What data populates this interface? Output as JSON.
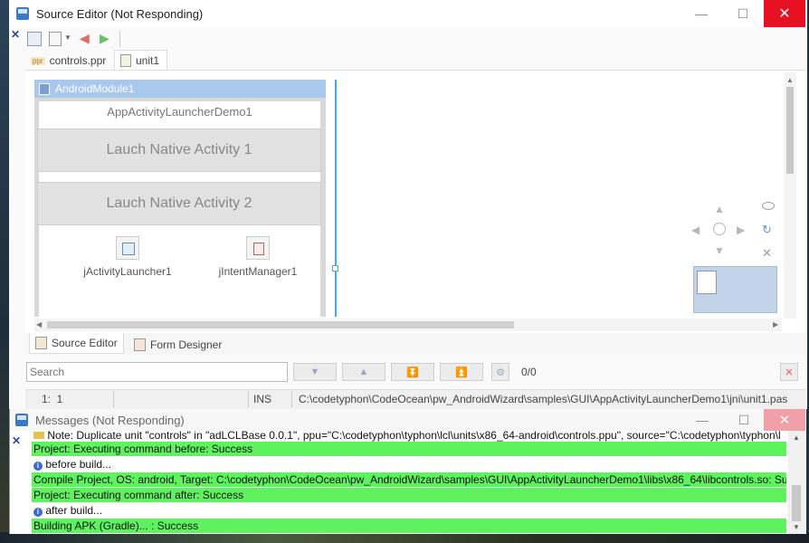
{
  "editor": {
    "title": "Source Editor (Not Responding)",
    "tabs": [
      "controls.ppr",
      "unit1"
    ],
    "tab_badge": "ppr",
    "bottom_tabs": [
      "Source Editor",
      "Form Designer"
    ],
    "search_placeholder": "Search",
    "search_count": "0/0",
    "status": {
      "position": "1:  1",
      "mode": "INS",
      "path": "C:\\codetyphon\\CodeOcean\\pw_AndroidWizard\\samples\\GUI\\AppActivityLauncherDemo1\\jni\\unit1.pas"
    }
  },
  "form": {
    "module_title": "AndroidModule1",
    "app_label": "AppActivityLauncherDemo1",
    "button1": "Lauch Native Activity 1",
    "button2": "Lauch Native Activity 2",
    "component1": "jActivityLauncher1",
    "component2": "jIntentManager1"
  },
  "messages": {
    "title": "Messages (Not Responding)",
    "lines": [
      {
        "text": "Note: Duplicate unit \"controls\" in \"adLCLBase 0.0.1\", ppu=\"C:\\codetyphon\\typhon\\lcl\\units\\x86_64-android\\controls.ppu\", source=\"C:\\codetyphon\\typhon\\l",
        "style": "white",
        "icon": "folder"
      },
      {
        "text": "Project: Executing command before: Success",
        "style": "green"
      },
      {
        "text": "before build...",
        "style": "white",
        "icon": "info"
      },
      {
        "text": "Compile Project, OS: android, Target: C:\\codetyphon\\CodeOcean\\pw_AndroidWizard\\samples\\GUI\\AppActivityLauncherDemo1\\libs\\x86_64\\libcontrols.so: Succ",
        "style": "green"
      },
      {
        "text": "Project: Executing command after: Success",
        "style": "green"
      },
      {
        "text": "after build...",
        "style": "white",
        "icon": "info"
      },
      {
        "text": "Building APK (Gradle)... : Success",
        "style": "green"
      }
    ]
  },
  "colors": {
    "close_red": "#e81123",
    "success_green": "#5ef25e",
    "module_blue": "#a8c8ec",
    "selection_blue": "#4aa8e8"
  }
}
